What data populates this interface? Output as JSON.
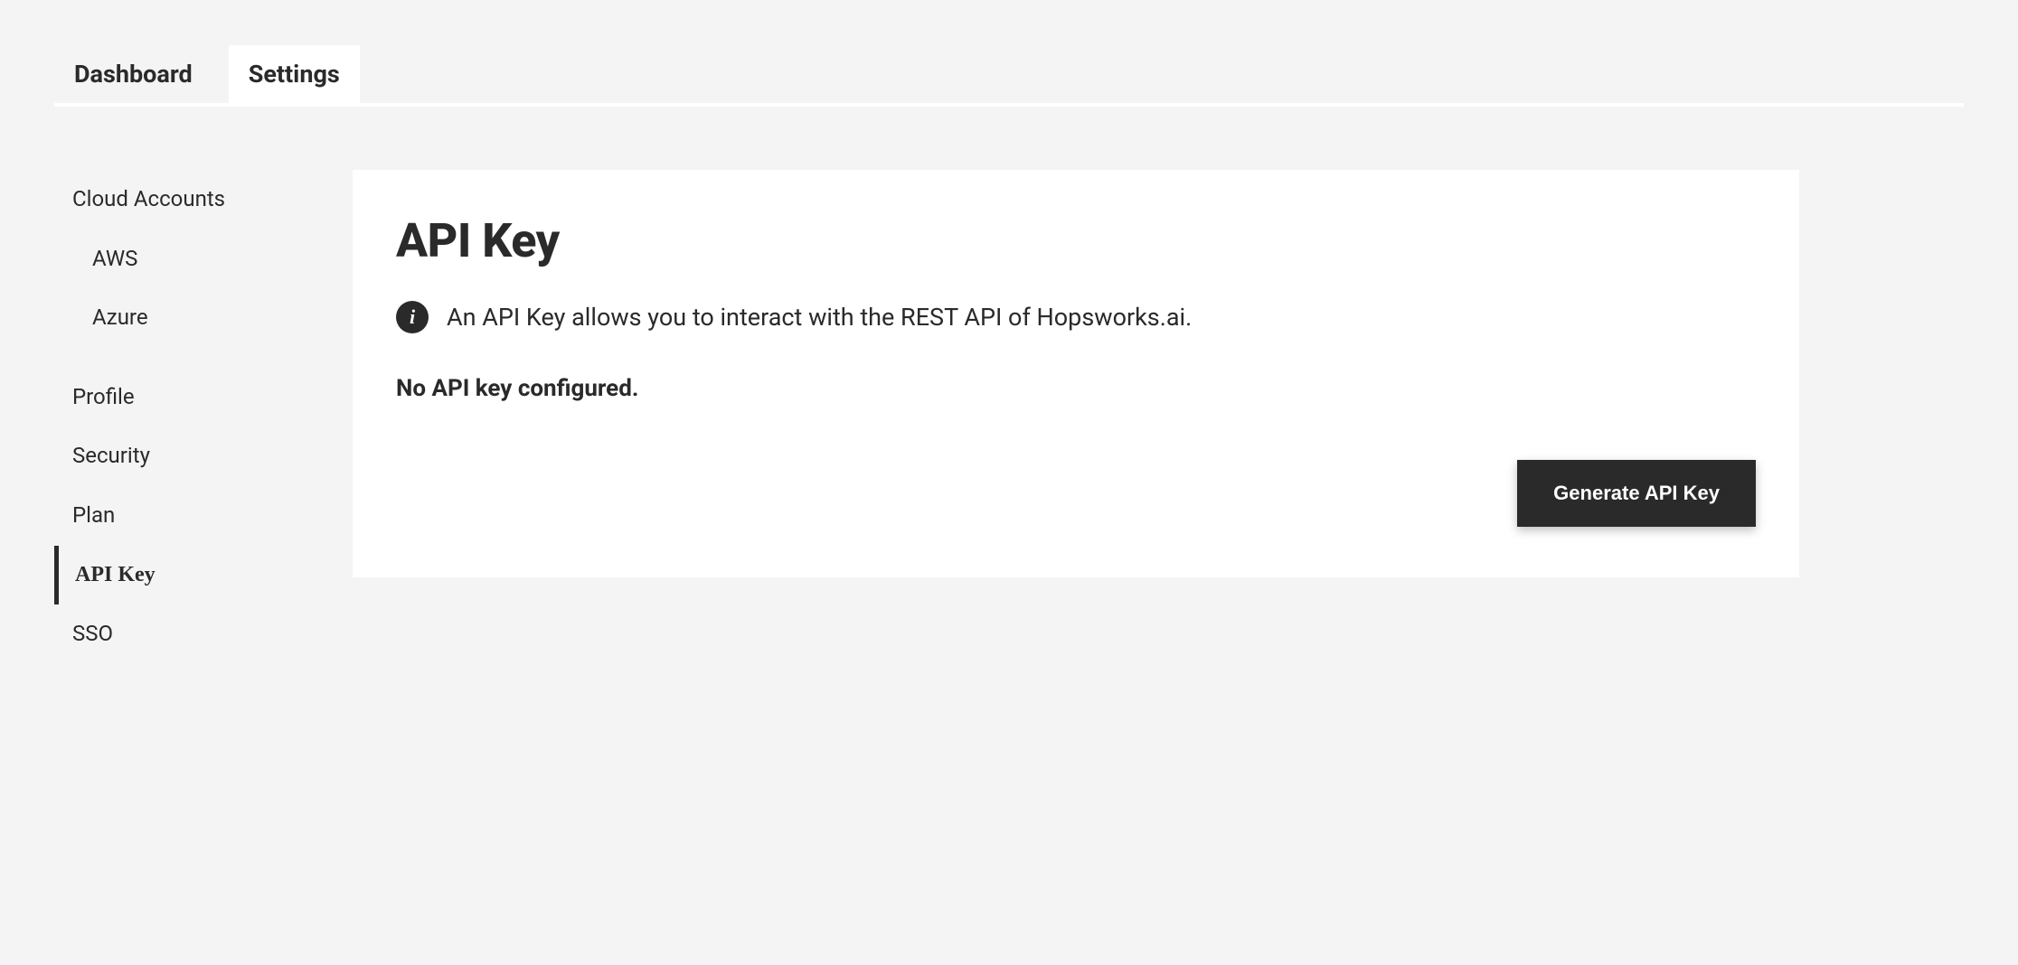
{
  "tabs": {
    "dashboard": "Dashboard",
    "settings": "Settings"
  },
  "sidebar": {
    "cloud_accounts": "Cloud Accounts",
    "aws": "AWS",
    "azure": "Azure",
    "profile": "Profile",
    "security": "Security",
    "plan": "Plan",
    "api_key": "API Key",
    "sso": "SSO"
  },
  "main": {
    "title": "API Key",
    "info": "An API Key allows you to interact with the REST API of Hopsworks.ai.",
    "status": "No API key configured.",
    "generate_button": "Generate API Key"
  }
}
